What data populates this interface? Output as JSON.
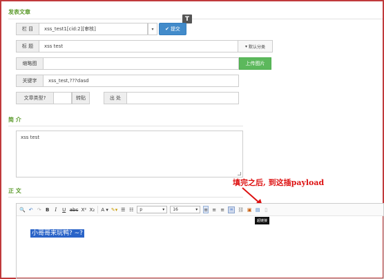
{
  "page": {
    "section_publish": "发表文章",
    "section_intro": "简 介",
    "section_body": "正 文"
  },
  "form": {
    "column_label": "栏 目",
    "column_value": "xss_test1[cid:2][审核]",
    "submit_label": "提交",
    "title_label": "标 题",
    "title_value": "xss test",
    "category_label": "默认分类",
    "thumb_label": "缩略图",
    "upload_label": "上传图片",
    "keywords_label": "关键字",
    "keywords_value": "xss_test,???dasd",
    "type_label": "文章类型?",
    "type_value": "",
    "repost_label": "转贴",
    "source_label": "出 处",
    "source_value": ""
  },
  "summary": {
    "value": "xss test"
  },
  "annotation": {
    "text": "填完之后, 到这插payload",
    "color": "#dd1111"
  },
  "editor": {
    "para_select": "p",
    "size_select": "16",
    "tooltip": "超链接",
    "content": "小哥哥来玩鸭? ~?",
    "highlight_color": "#2a64c8"
  },
  "icons": {
    "t_badge": "T",
    "checkmark": "✔"
  }
}
